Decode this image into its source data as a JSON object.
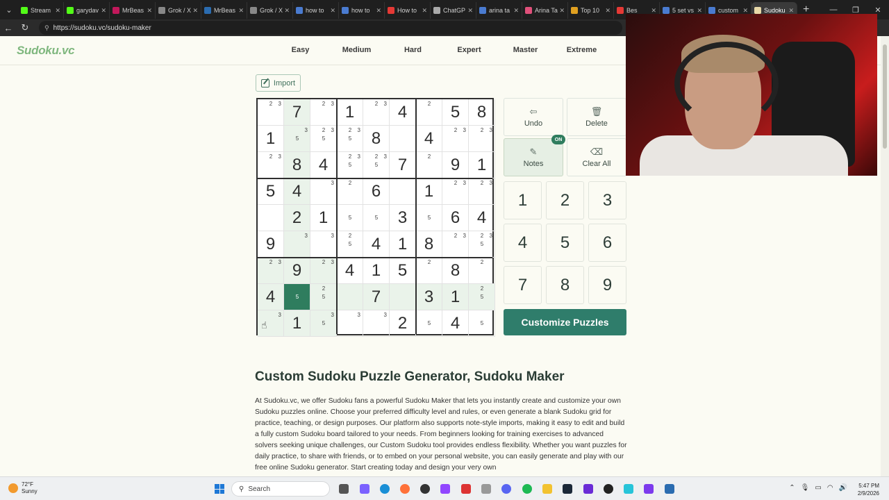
{
  "browser": {
    "tabs": [
      {
        "label": "Stream",
        "color": "#53fc18"
      },
      {
        "label": "garydav",
        "color": "#53fc18"
      },
      {
        "label": "MrBeas",
        "color": "#c2185b"
      },
      {
        "label": "Grok / X",
        "color": "#888888"
      },
      {
        "label": "MrBeas",
        "color": "#2b6cb0"
      },
      {
        "label": "Grok / X",
        "color": "#888888"
      },
      {
        "label": "how to",
        "color": "#4a7bd0"
      },
      {
        "label": "how to",
        "color": "#4a7bd0"
      },
      {
        "label": "How to",
        "color": "#e53935"
      },
      {
        "label": "ChatGP",
        "color": "#aaaaaa"
      },
      {
        "label": "arina ta",
        "color": "#4a7bd0"
      },
      {
        "label": "Arina Ta",
        "color": "#e0507a"
      },
      {
        "label": "Top 10",
        "color": "#e0a020"
      },
      {
        "label": "Bes",
        "color": "#e53935"
      },
      {
        "label": "5 set vs",
        "color": "#4a7bd0"
      },
      {
        "label": "custom",
        "color": "#4a7bd0"
      },
      {
        "label": "Sudoku",
        "color": "#e8d9a8",
        "active": true
      }
    ],
    "url": "https://sudoku.vc/sudoku-maker"
  },
  "site": {
    "logo": "Sudoku.vc",
    "nav": [
      "Easy",
      "Medium",
      "Hard",
      "Expert",
      "Master",
      "Extreme"
    ]
  },
  "import_label": "Import",
  "board": {
    "highlight_row": 7,
    "highlight_col": 1,
    "selected": [
      7,
      1
    ],
    "cells": [
      [
        {
          "n": [
            2,
            3
          ]
        },
        {
          "v": 7
        },
        {
          "n": [
            2,
            3
          ]
        },
        {
          "v": 1
        },
        {
          "n": [
            2,
            3
          ]
        },
        {
          "v": 4
        },
        {
          "n": [
            2
          ]
        },
        {
          "v": 5
        },
        {
          "v": 8
        }
      ],
      [
        {
          "v": 1
        },
        {
          "n": [
            3,
            5
          ]
        },
        {
          "n": [
            2,
            3,
            5
          ]
        },
        {
          "n": [
            2,
            3,
            5
          ]
        },
        {
          "v": 8
        },
        {
          "n": []
        },
        {
          "v": 4
        },
        {
          "n": [
            2,
            3
          ]
        },
        {
          "n": [
            2,
            3
          ]
        }
      ],
      [
        {
          "n": [
            2,
            3
          ]
        },
        {
          "v": 8
        },
        {
          "v": 4
        },
        {
          "n": [
            2,
            3,
            5
          ]
        },
        {
          "n": [
            2,
            3,
            5
          ]
        },
        {
          "v": 7
        },
        {
          "n": [
            2
          ]
        },
        {
          "v": 9
        },
        {
          "v": 1
        }
      ],
      [
        {
          "v": 5
        },
        {
          "v": 4
        },
        {
          "n": [
            3
          ]
        },
        {
          "n": [
            2
          ]
        },
        {
          "v": 6
        },
        {
          "n": []
        },
        {
          "v": 1
        },
        {
          "n": [
            2,
            3
          ]
        },
        {
          "n": [
            2,
            3
          ]
        }
      ],
      [
        {
          "n": []
        },
        {
          "v": 2
        },
        {
          "v": 1
        },
        {
          "n": [
            5
          ]
        },
        {
          "n": [
            5
          ]
        },
        {
          "v": 3
        },
        {
          "n": [
            5
          ]
        },
        {
          "v": 6
        },
        {
          "v": 4
        }
      ],
      [
        {
          "v": 9
        },
        {
          "n": [
            3
          ]
        },
        {
          "n": [
            3
          ]
        },
        {
          "n": [
            2,
            5
          ]
        },
        {
          "v": 4
        },
        {
          "v": 1
        },
        {
          "v": 8
        },
        {
          "n": [
            2,
            3
          ]
        },
        {
          "n": [
            2,
            3,
            5
          ]
        }
      ],
      [
        {
          "n": [
            2,
            3
          ]
        },
        {
          "v": 9
        },
        {
          "n": [
            2,
            3
          ]
        },
        {
          "v": 4
        },
        {
          "v": 1
        },
        {
          "v": 5
        },
        {
          "n": [
            2
          ]
        },
        {
          "v": 8
        },
        {
          "n": [
            2
          ]
        }
      ],
      [
        {
          "v": 4
        },
        {
          "n": [
            5
          ]
        },
        {
          "n": [
            2,
            5
          ]
        },
        {
          "n": []
        },
        {
          "v": 7
        },
        {
          "n": []
        },
        {
          "v": 3
        },
        {
          "v": 1
        },
        {
          "n": [
            2,
            5
          ]
        }
      ],
      [
        {
          "n": [
            3
          ]
        },
        {
          "v": 1
        },
        {
          "n": [
            3,
            5
          ]
        },
        {
          "n": [
            3
          ]
        },
        {
          "n": [
            3
          ]
        },
        {
          "v": 2
        },
        {
          "n": [
            5
          ]
        },
        {
          "v": 4
        },
        {
          "n": [
            5
          ]
        }
      ]
    ]
  },
  "controls": {
    "undo": "Undo",
    "delete": "Delete",
    "notes": "Notes",
    "notes_badge": "ON",
    "clear_all": "Clear All"
  },
  "numpad": [
    "1",
    "2",
    "3",
    "4",
    "5",
    "6",
    "7",
    "8",
    "9"
  ],
  "customize_label": "Customize Puzzles",
  "article": {
    "title": "Custom Sudoku Puzzle Generator, Sudoku Maker",
    "body": "At Sudoku.vc, we offer Sudoku fans a powerful Sudoku Maker that lets you instantly create and customize your own Sudoku puzzles online. Choose your preferred difficulty level and rules, or even generate a blank Sudoku grid for practice, teaching, or design purposes. Our platform also supports note-style imports, making it easy to edit and build a fully custom Sudoku board tailored to your needs. From beginners looking for training exercises to advanced solvers seeking unique challenges, our Custom Sudoku tool provides endless flexibility. Whether you want puzzles for daily practice, to share with friends, or to embed on your personal website, you can easily generate and play with our free online Sudoku generator. Start creating today and design your very own"
  },
  "taskbar": {
    "weather_temp": "72°F",
    "weather_desc": "Sunny",
    "search": "Search",
    "time": "5:47 PM",
    "date": "2/9/2026"
  }
}
